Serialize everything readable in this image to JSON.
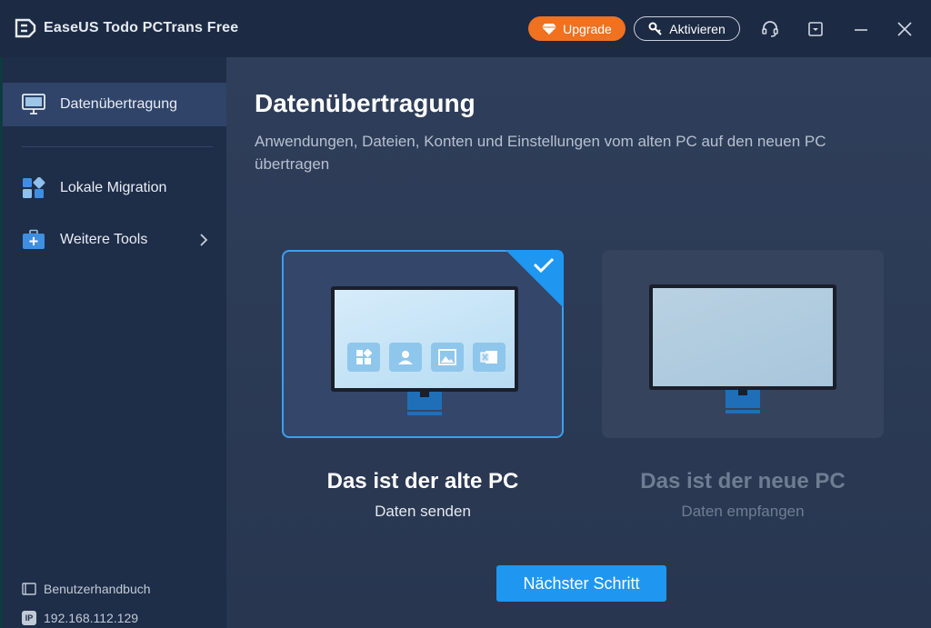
{
  "window": {
    "title": "EaseUS Todo PCTrans Free",
    "upgrade_label": "Upgrade",
    "activate_label": "Aktivieren",
    "icons": [
      "app-logo-icon",
      "diamond-icon",
      "key-icon",
      "headset-icon",
      "dropdown-menu-icon",
      "minimize-icon",
      "close-icon"
    ]
  },
  "sidebar": {
    "items": [
      {
        "label": "Datenübertragung",
        "icon": "monitor-icon",
        "active": true
      },
      {
        "label": "Lokale Migration",
        "icon": "grid-apps-icon",
        "active": false
      },
      {
        "label": "Weitere Tools",
        "icon": "toolbox-icon",
        "active": false,
        "has_submenu": true
      }
    ],
    "footer": {
      "manual_label": "Benutzerhandbuch",
      "ip_badge": "IP",
      "ip_address": "192.168.112.129"
    }
  },
  "main": {
    "title": "Datenübertragung",
    "subtitle": "Anwendungen, Dateien, Konten und Einstellungen vom alten PC auf den neuen PC übertragen",
    "options": [
      {
        "title": "Das ist der alte PC",
        "subtitle": "Daten senden",
        "selected": true
      },
      {
        "title": "Das ist der neue PC",
        "subtitle": "Daten empfangen",
        "selected": false
      }
    ],
    "next_button": "Nächster Schritt"
  },
  "colors": {
    "accent": "#1f97f0",
    "upgrade": "#f0711f",
    "sidebar_bg": "#1e2d48",
    "main_bg": "#2f3e5a"
  }
}
